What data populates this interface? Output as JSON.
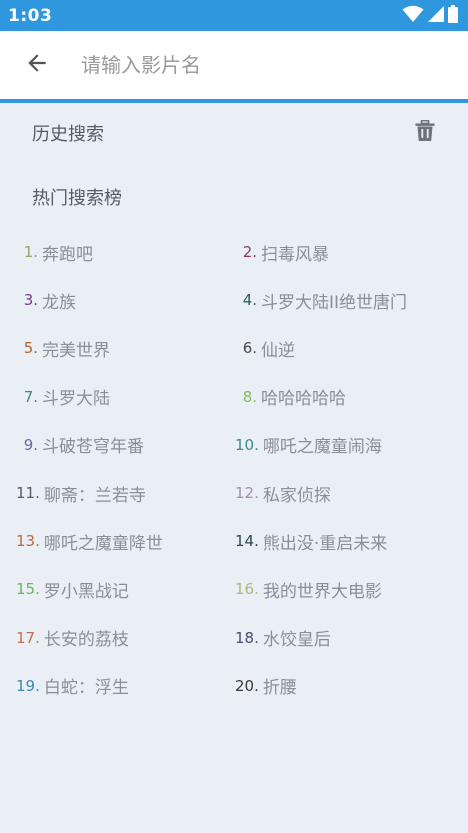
{
  "status_bar": {
    "time": "1:03"
  },
  "search": {
    "placeholder": "请输入影片名"
  },
  "history": {
    "title": "历史搜索"
  },
  "hot": {
    "title": "热门搜索榜",
    "items": [
      {
        "rank": "1.",
        "label": "奔跑吧",
        "color": "#9aa36a"
      },
      {
        "rank": "2.",
        "label": "扫毒风暴",
        "color": "#8b3a62"
      },
      {
        "rank": "3.",
        "label": "龙族",
        "color": "#7e3a8a"
      },
      {
        "rank": "4.",
        "label": "斗罗大陆II绝世唐门",
        "color": "#2e5a5a"
      },
      {
        "rank": "5.",
        "label": "完美世界",
        "color": "#b5652a"
      },
      {
        "rank": "6.",
        "label": "仙逆",
        "color": "#4a4a4a"
      },
      {
        "rank": "7.",
        "label": "斗罗大陆",
        "color": "#3f8a7a"
      },
      {
        "rank": "8.",
        "label": "哈哈哈哈哈",
        "color": "#7fbf5a"
      },
      {
        "rank": "9.",
        "label": "斗破苍穹年番",
        "color": "#6a6a9a"
      },
      {
        "rank": "10.",
        "label": "哪吒之魔童闹海",
        "color": "#3f8a8a"
      },
      {
        "rank": "11.",
        "label": "聊斋：兰若寺",
        "color": "#5a5a6a"
      },
      {
        "rank": "12.",
        "label": "私家侦探",
        "color": "#a58ab5"
      },
      {
        "rank": "13.",
        "label": "哪吒之魔童降世",
        "color": "#c06a3a"
      },
      {
        "rank": "14.",
        "label": "熊出没·重启未来",
        "color": "#2e4a4a"
      },
      {
        "rank": "15.",
        "label": "罗小黑战记",
        "color": "#6ab55a"
      },
      {
        "rank": "16.",
        "label": "我的世界大电影",
        "color": "#b5b57a"
      },
      {
        "rank": "17.",
        "label": "长安的荔枝",
        "color": "#c0704a"
      },
      {
        "rank": "18.",
        "label": "水饺皇后",
        "color": "#4a4a7a"
      },
      {
        "rank": "19.",
        "label": "白蛇：浮生",
        "color": "#3a8ab5"
      },
      {
        "rank": "20.",
        "label": "折腰",
        "color": "#3a3a3a"
      }
    ]
  },
  "icons": {
    "back": "arrow-left-icon",
    "trash": "trash-icon",
    "wifi": "wifi-icon",
    "signal": "signal-icon",
    "battery": "battery-icon"
  },
  "colors": {
    "accent": "#2f97dd",
    "background": "#e9eff5",
    "text_primary": "#555b63",
    "text_secondary": "#8a8f96"
  }
}
